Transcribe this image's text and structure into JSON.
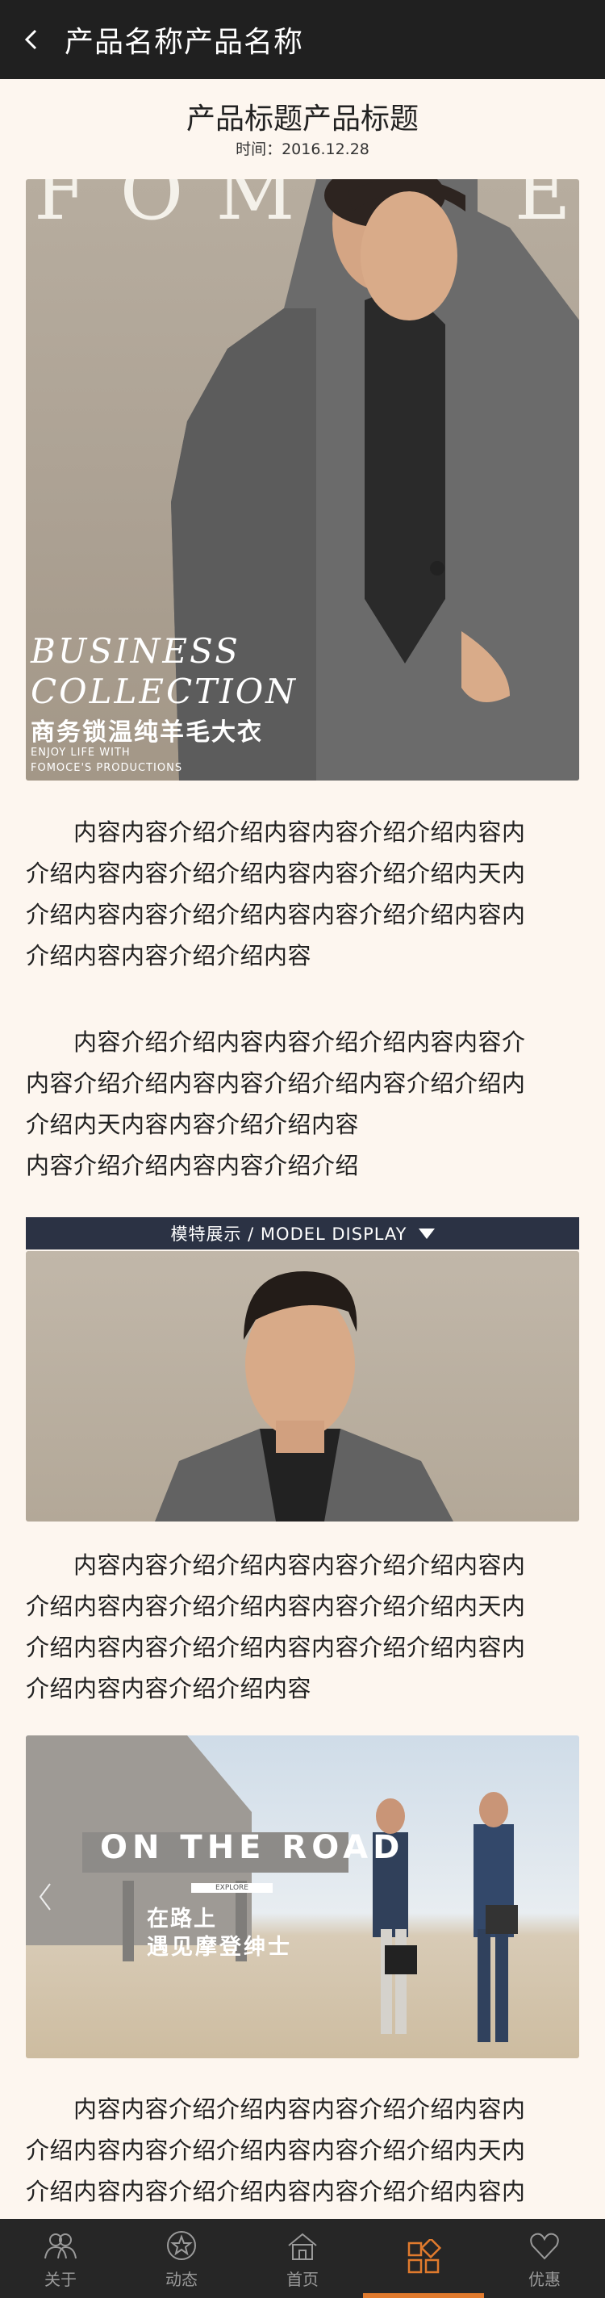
{
  "header": {
    "title": "产品名称产品名称"
  },
  "article": {
    "title": "产品标题产品标题",
    "time": "时间：2016.12.28"
  },
  "banner1": {
    "brand": "FOMOCE",
    "line1": "BUSINESS",
    "line2": "COLLECTION",
    "cn": "商务锁温纯羊毛大衣",
    "small1": "ENJOY LIFE WITH",
    "small2": "FOMOCE'S PRODUCTIONS"
  },
  "para1": [
    "　　内容内容介绍介绍内容内容介绍介绍内容内",
    "介绍内容内容介绍介绍内容内容介绍介绍内天内",
    "介绍内容内容介绍介绍内容内容介绍介绍内容内",
    "介绍内容内容介绍介绍内容"
  ],
  "para2": [
    "　　内容介绍介绍内容内容介绍介绍内容内容介",
    "内容介绍介绍内容内容介绍介绍内容介绍介绍内",
    "介绍内天内容内容介绍介绍内容",
    "内容介绍介绍内容内容介绍介绍"
  ],
  "model_banner": {
    "label": "模特展示 / MODEL DISPLAY"
  },
  "para3": [
    "　　内容内容介绍介绍内容内容介绍介绍内容内",
    "介绍内容内容介绍介绍内容内容介绍介绍内天内",
    "介绍内容内容介绍介绍内容内容介绍介绍内容内",
    "介绍内容内容介绍介绍内容"
  ],
  "banner3": {
    "headline": "ON THE ROAD",
    "tag": "EXPLORE",
    "cn1": "在路上",
    "cn2": "遇见摩登绅士"
  },
  "para4": [
    "　　内容内容介绍介绍内容内容介绍介绍内容内",
    "介绍内容内容介绍介绍内容内容介绍介绍内天内",
    "介绍内容内容介绍介绍内容内容介绍介绍内容内"
  ],
  "tabs": [
    {
      "label": "关于",
      "icon": "people-icon"
    },
    {
      "label": "动态",
      "icon": "star-circle-icon"
    },
    {
      "label": "首页",
      "icon": "home-icon"
    },
    {
      "label": "",
      "icon": "grid-icon",
      "active": true
    },
    {
      "label": "优惠",
      "icon": "heart-icon"
    }
  ],
  "colors": {
    "accent": "#e07a2d",
    "header_bg": "#202020",
    "page_bg": "#fdf6ef",
    "banner_bg": "#2b3244"
  }
}
